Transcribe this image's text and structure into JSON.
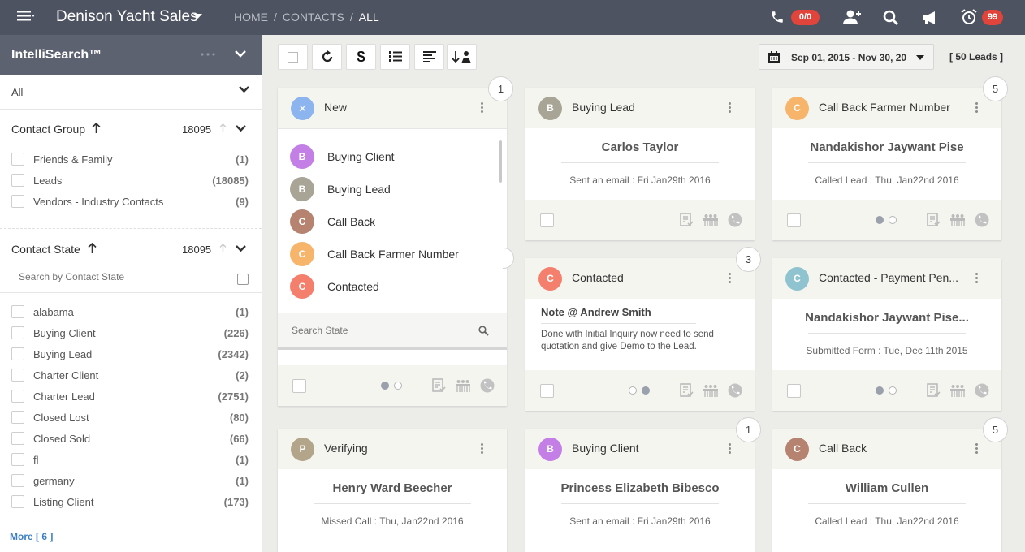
{
  "app": {
    "title": "Denison Yacht Sales",
    "breadcrumb": [
      "HOME",
      "CONTACTS",
      "ALL"
    ]
  },
  "header": {
    "phone_badge": "0/0",
    "alarm_badge": "99"
  },
  "colors": {
    "topbar": "#4d5360",
    "intellisearch": "#5c6270",
    "badge": "#e0443a",
    "link": "#3b7fc4"
  },
  "icons": [
    "menu-icon",
    "chevron-down-icon",
    "phone-icon",
    "add-user-icon",
    "search-icon",
    "megaphone-icon",
    "alarm-clock-icon",
    "refresh-icon",
    "dollar-icon",
    "list-icon",
    "align-left-icon",
    "sort-user-icon",
    "calendar-icon",
    "note-icon",
    "people-icon",
    "call-icon"
  ],
  "sidebar": {
    "title": "IntelliSearch™",
    "filter_value": "All",
    "contact_group": {
      "title": "Contact Group",
      "count": "18095",
      "items": [
        {
          "label": "Friends & Family",
          "count": "(1)"
        },
        {
          "label": "Leads",
          "count": "(18085)"
        },
        {
          "label": "Vendors - Industry Contacts",
          "count": "(9)"
        }
      ]
    },
    "contact_state": {
      "title": "Contact State",
      "count": "18095",
      "search_placeholder": "Search by Contact State",
      "items": [
        {
          "label": "alabama",
          "count": "(1)"
        },
        {
          "label": "Buying Client",
          "count": "(226)"
        },
        {
          "label": "Buying Lead",
          "count": "(2342)"
        },
        {
          "label": "Charter Client",
          "count": "(2)"
        },
        {
          "label": "Charter Lead",
          "count": "(2751)"
        },
        {
          "label": "Closed Lost",
          "count": "(80)"
        },
        {
          "label": "Closed Sold",
          "count": "(66)"
        },
        {
          "label": "fl",
          "count": "(1)"
        },
        {
          "label": "germany",
          "count": "(1)"
        },
        {
          "label": "Listing Client",
          "count": "(173)"
        }
      ],
      "more": "More [ 6 ]"
    }
  },
  "toolbar": {
    "date_range": "Sep 01, 2015 - Nov 30, 20",
    "lead_count": "[ 50 Leads ]"
  },
  "dropdown_card": {
    "state": "New",
    "avatar_symbol": "×",
    "corner": "1",
    "options": [
      {
        "label": "Buying Client",
        "letter": "B",
        "color": "#c47fe6"
      },
      {
        "label": "Buying Lead",
        "letter": "B",
        "color": "#a8a596"
      },
      {
        "label": "Call Back",
        "letter": "C",
        "color": "#b5836f"
      },
      {
        "label": "Call Back Farmer Number",
        "letter": "C",
        "color": "#f6b56b"
      },
      {
        "label": "Contacted",
        "letter": "C",
        "color": "#f47f6d"
      }
    ],
    "search_placeholder": "Search State"
  },
  "cards": [
    {
      "state": "Buying Lead",
      "letter": "B",
      "color": "#a8a596",
      "corner": "",
      "name": "Carlos Taylor",
      "activity": "Sent an email :  Fri Jan29th 2016",
      "dots": false
    },
    {
      "state": "Call Back Farmer Number",
      "letter": "C",
      "color": "#f6b56b",
      "corner": "5",
      "name": "Nandakishor Jaywant Pise",
      "activity": "Called Lead :   Thu, Jan22nd 2016",
      "dots": true
    },
    {
      "state": "Contacted",
      "letter": "C",
      "color": "#f47f6d",
      "corner": "3",
      "note_title": "Note @ Andrew Smith",
      "note_text": "Done with Initial Inquiry now need to send quotation and give Demo to the Lead.",
      "dots": true
    },
    {
      "state": "Contacted - Payment Pen...",
      "letter": "C",
      "color": "#8fc3d0",
      "corner": "",
      "name": "Nandakishor Jaywant Pise...",
      "activity": "Submitted Form :  Tue, Dec 11th 2015",
      "dots": true
    },
    {
      "state": "Verifying",
      "letter": "P",
      "color": "#b3a58a",
      "corner": "",
      "name": "Henry Ward Beecher",
      "activity": "Missed Call :  Thu, Jan22nd 2016"
    },
    {
      "state": "Buying Client",
      "letter": "B",
      "color": "#c47fe6",
      "corner": "1",
      "name": "Princess Elizabeth Bibesco",
      "activity": "Sent an email :  Fri Jan29th 2016"
    },
    {
      "state": "Call Back",
      "letter": "C",
      "color": "#b5836f",
      "corner": "5",
      "name": "William Cullen",
      "activity": "Called Lead :   Thu, Jan22nd 2016"
    }
  ]
}
